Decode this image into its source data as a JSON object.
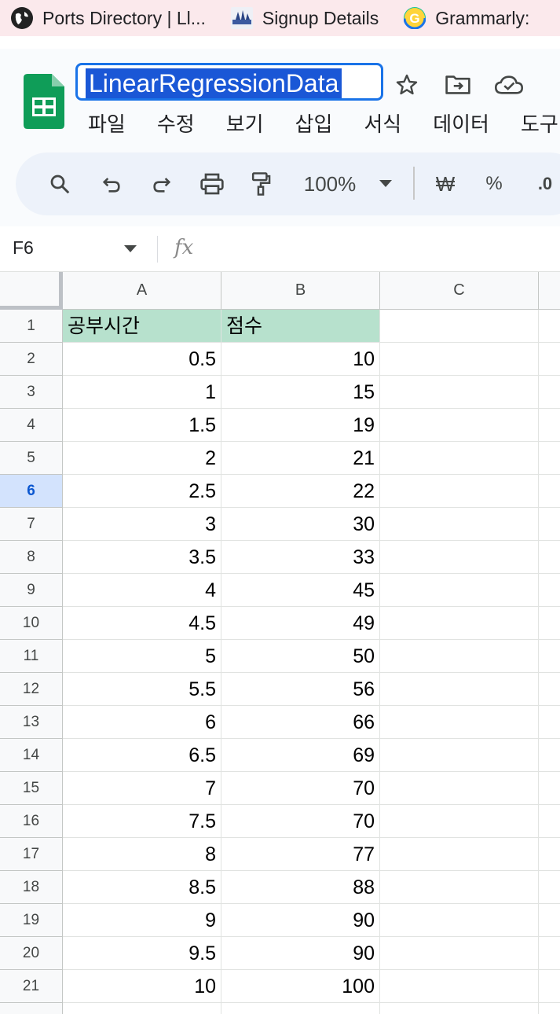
{
  "bookmarks": [
    {
      "label": "Ports Directory | Ll...",
      "icon": "globe-icon"
    },
    {
      "label": "Signup Details",
      "icon": "signup-icon"
    },
    {
      "label": "Grammarly:",
      "icon": "grammarly-icon"
    }
  ],
  "document": {
    "title": "LinearRegressionData"
  },
  "menu": [
    "파일",
    "수정",
    "보기",
    "삽입",
    "서식",
    "데이터",
    "도구"
  ],
  "toolbar": {
    "zoom": "100%",
    "currency": "₩",
    "percent": "%",
    "decimal": ".0"
  },
  "formula_bar": {
    "cell_ref": "F6",
    "fx": "fx",
    "content": ""
  },
  "columns": [
    "A",
    "B",
    "C"
  ],
  "selected_row": 6,
  "rows": [
    {
      "num": "1",
      "a": "공부시간",
      "b": "점수"
    },
    {
      "num": "2",
      "a": "0.5",
      "b": "10"
    },
    {
      "num": "3",
      "a": "1",
      "b": "15"
    },
    {
      "num": "4",
      "a": "1.5",
      "b": "19"
    },
    {
      "num": "5",
      "a": "2",
      "b": "21"
    },
    {
      "num": "6",
      "a": "2.5",
      "b": "22"
    },
    {
      "num": "7",
      "a": "3",
      "b": "30"
    },
    {
      "num": "8",
      "a": "3.5",
      "b": "33"
    },
    {
      "num": "9",
      "a": "4",
      "b": "45"
    },
    {
      "num": "10",
      "a": "4.5",
      "b": "49"
    },
    {
      "num": "11",
      "a": "5",
      "b": "50"
    },
    {
      "num": "12",
      "a": "5.5",
      "b": "56"
    },
    {
      "num": "13",
      "a": "6",
      "b": "66"
    },
    {
      "num": "14",
      "a": "6.5",
      "b": "69"
    },
    {
      "num": "15",
      "a": "7",
      "b": "70"
    },
    {
      "num": "16",
      "a": "7.5",
      "b": "70"
    },
    {
      "num": "17",
      "a": "8",
      "b": "77"
    },
    {
      "num": "18",
      "a": "8.5",
      "b": "88"
    },
    {
      "num": "19",
      "a": "9",
      "b": "90"
    },
    {
      "num": "20",
      "a": "9.5",
      "b": "90"
    },
    {
      "num": "21",
      "a": "10",
      "b": "100"
    }
  ],
  "colors": {
    "header_fill": "#b7e1cd",
    "accent": "#1a73e8"
  }
}
